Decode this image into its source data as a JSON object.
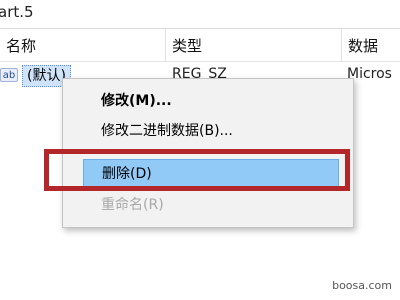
{
  "path": {
    "text": "art.5"
  },
  "columns": {
    "name": "名称",
    "type": "类型",
    "data": "数据"
  },
  "row": {
    "icon_label": "ab",
    "name": "(默认)",
    "type": "REG_SZ",
    "data": "Micros"
  },
  "context_menu": {
    "modify": "修改(M)...",
    "modify_binary": "修改二进制数据(B)...",
    "delete": "删除(D)",
    "rename": "重命名(R)"
  },
  "colors": {
    "highlight_border": "#b3262a",
    "delete_hover": "#91c9f7",
    "disabled_text": "#a8a8a8"
  },
  "watermark": "boosa.com"
}
